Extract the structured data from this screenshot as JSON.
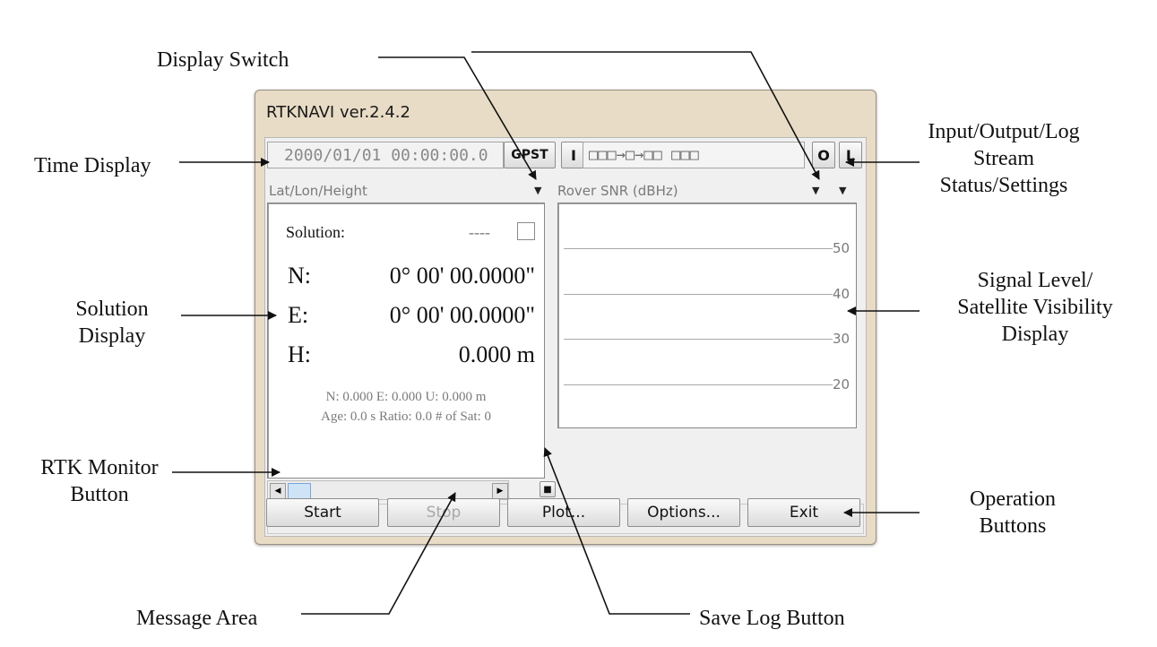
{
  "window": {
    "title": "RTKNAVI ver.2.4.2",
    "time": "2000/01/01 00:00:00.0",
    "time_system_btn": "GPST",
    "input_btn": "I",
    "stream_status": "□□□→□→□□ □□□",
    "output_btn": "O",
    "log_btn": "L",
    "left_selector": "Lat/Lon/Height",
    "right_selector": "Rover  SNR (dBHz)",
    "solution": {
      "label": "Solution:",
      "status": "----",
      "n_label": "N:",
      "n_value": "0° 00' 00.0000\"",
      "e_label": "E:",
      "e_value": "0° 00' 00.0000\"",
      "h_label": "H:",
      "h_value": "0.000 m",
      "stats_line1": "N: 0.000 E: 0.000 U: 0.000 m",
      "stats_line2": "Age: 0.0 s Ratio: 0.0 # of Sat: 0"
    },
    "snr_ticks": [
      "50",
      "40",
      "30",
      "20"
    ],
    "status_help": "?",
    "buttons": {
      "start": "Start",
      "stop": "Stop",
      "plot": "Plot...",
      "options": "Options...",
      "exit": "Exit"
    }
  },
  "callouts": {
    "display_switch": "Display Switch",
    "time_display": "Time Display",
    "io_log_line1": "Input/Output/Log",
    "io_log_line2": "Stream",
    "io_log_line3": "Status/Settings",
    "solution_line1": "Solution",
    "solution_line2": "Display",
    "signal_line1": "Signal Level/",
    "signal_line2": "Satellite Visibility",
    "signal_line3": "Display",
    "rtk_line1": "RTK Monitor",
    "rtk_line2": "Button",
    "operation_line1": "Operation",
    "operation_line2": "Buttons",
    "message_area": "Message Area",
    "save_log": "Save Log Button"
  }
}
